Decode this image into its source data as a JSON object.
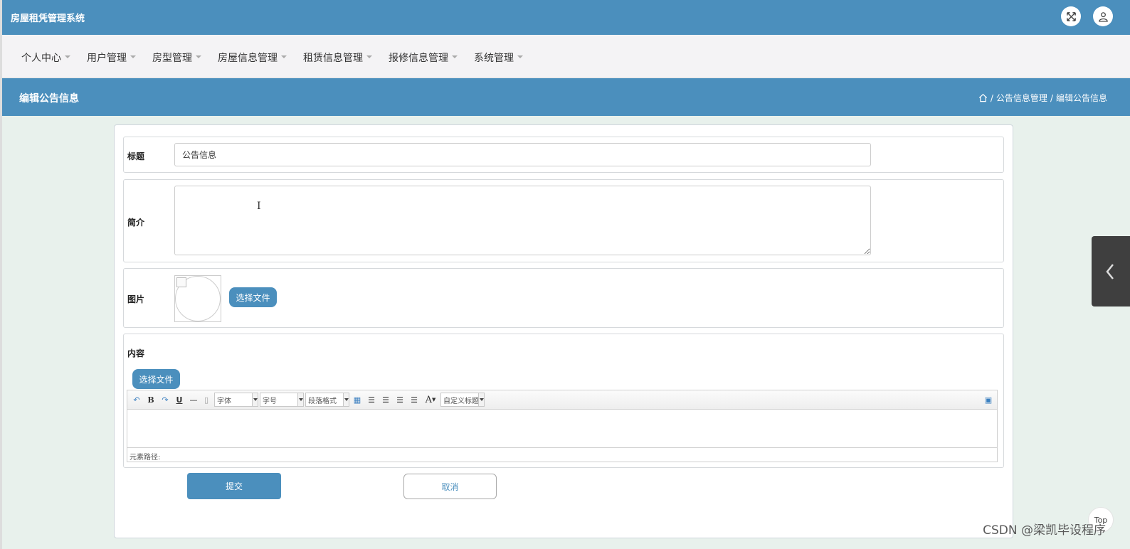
{
  "app": {
    "title": "房屋租凭管理系统"
  },
  "header_icons": [
    "fullscreen-icon",
    "user-icon"
  ],
  "nav": {
    "items": [
      {
        "label": "个人中心"
      },
      {
        "label": "用户管理"
      },
      {
        "label": "房型管理"
      },
      {
        "label": "房屋信息管理"
      },
      {
        "label": "租赁信息管理"
      },
      {
        "label": "报修信息管理"
      },
      {
        "label": "系统管理"
      }
    ]
  },
  "page": {
    "title": "编辑公告信息",
    "breadcrumb": {
      "section": "公告信息管理",
      "separator": "/",
      "current": "编辑公告信息"
    }
  },
  "form": {
    "title_label": "标题",
    "title_value": "公告信息",
    "intro_label": "简介",
    "intro_value": "",
    "image_label": "图片",
    "image_button": "选择文件",
    "content_label": "内容",
    "content_button": "选择文件",
    "submit": "提交",
    "cancel": "取消"
  },
  "editor": {
    "font_family": "字体",
    "font_size": "字号",
    "paragraph": "段落格式",
    "custom_title": "自定义标题",
    "path_label": "元素路径:",
    "bold": "B",
    "underline": "U",
    "font_color": "A"
  },
  "misc": {
    "top_button": "Top",
    "watermark": "CSDN @梁凯毕设程序"
  },
  "colors": {
    "primary": "#4b8fbd",
    "nav_bg": "#f4f3f5",
    "side_tab": "#3f3f3f"
  }
}
